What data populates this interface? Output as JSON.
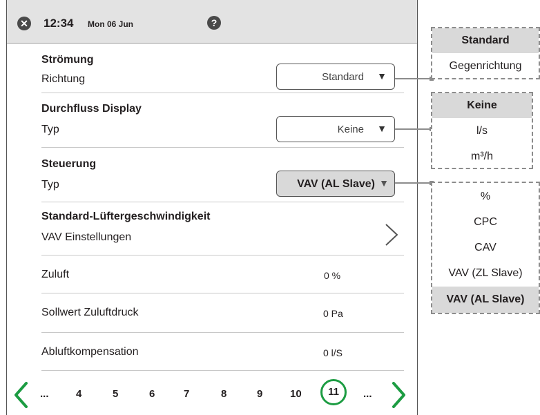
{
  "status_bar": {
    "time": "12:34",
    "date": "Mon 06 Jun",
    "close_icon": "close-icon",
    "help_icon": "help-icon"
  },
  "settings": {
    "stroemung": {
      "heading": "Strömung",
      "label": "Richtung",
      "value": "Standard"
    },
    "durchfluss": {
      "heading": "Durchfluss Display",
      "label": "Typ",
      "value": "Keine"
    },
    "steuerung": {
      "heading": "Steuerung",
      "label": "Typ",
      "value": "VAV (AL Slave)"
    },
    "luefter": {
      "heading": "Standard-Lüftergeschwindigkeit",
      "label": "VAV Einstellungen"
    },
    "zuluft": {
      "label": "Zuluft",
      "value": "0 %"
    },
    "sollwert": {
      "label": "Sollwert Zuluftdruck",
      "value": "0 Pa"
    },
    "abluft": {
      "label": "Abluftkompensation",
      "value": "0 l/S"
    }
  },
  "pager": {
    "items": [
      "...",
      "4",
      "5",
      "6",
      "7",
      "8",
      "9",
      "10",
      "11",
      "..."
    ],
    "current": "11"
  },
  "options": {
    "richtung": [
      "Standard",
      "Gegenrichtung"
    ],
    "richtung_selected": "Standard",
    "durchfluss": [
      "Keine",
      "l/s",
      "m³/h"
    ],
    "durchfluss_selected": "Keine",
    "steuerung": [
      "%",
      "CPC",
      "CAV",
      "VAV (ZL Slave)",
      "VAV (AL Slave)"
    ],
    "steuerung_selected": "VAV (AL Slave)"
  },
  "colors": {
    "accent_green": "#1c9c42",
    "status_bar": "#e3e3e3",
    "selected_option": "#d9d9d9"
  }
}
